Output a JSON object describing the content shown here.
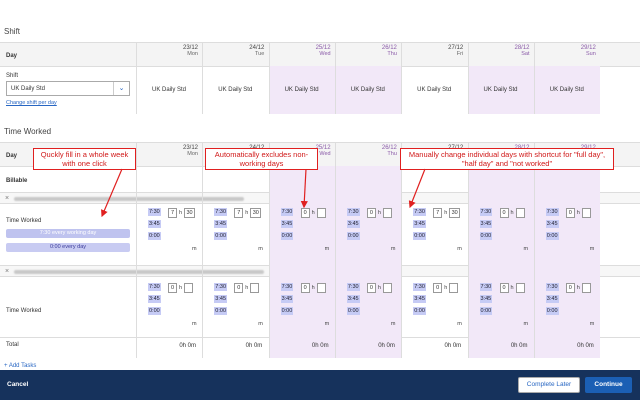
{
  "shift_section": {
    "title": "Shift",
    "day_label": "Day",
    "row_label": "Shift",
    "select_value": "UK Daily Std",
    "change_link": "Change shift per day",
    "cell_value": "UK Daily Std"
  },
  "days": [
    {
      "date": "23/12",
      "name": "Mon",
      "weekend": false
    },
    {
      "date": "24/12",
      "name": "Tue",
      "weekend": false
    },
    {
      "date": "25/12",
      "name": "Wed",
      "weekend": true
    },
    {
      "date": "26/12",
      "name": "Thu",
      "weekend": true
    },
    {
      "date": "27/12",
      "name": "Fri",
      "weekend": false
    },
    {
      "date": "28/12",
      "name": "Sat",
      "weekend": true
    },
    {
      "date": "29/12",
      "name": "Sun",
      "weekend": true
    }
  ],
  "time_worked": {
    "title": "Time Worked",
    "day_label": "Day",
    "billable_label": "Billable",
    "row_label": "Time Worked",
    "fill_every_working_day": "7:30 every working day",
    "fill_every_day": "0:00 every day",
    "total_label": "Total",
    "total_value": "0h 0m",
    "chip_full": "7:30",
    "chip_half": "3:45",
    "chip_zero": "0:00",
    "hours_unit": "h",
    "minutes_unit": "m",
    "edited_hours": "7",
    "edited_minutes": "30",
    "default_hours": "0"
  },
  "callouts": {
    "one_click": "Quckly fill in a whole week with one click",
    "excludes": "Automatically excludes non-working days",
    "manual": "Manually change individual days with shortcut for \"full day\", \"half day\" and \"not worked\""
  },
  "footer": {
    "add_tasks": "+ Add Tasks",
    "cancel": "Cancel",
    "complete_later": "Complete Later",
    "continue": "Continue"
  },
  "colors": {
    "weekend_bg": "#f2e8f8",
    "chip_bg": "#c6cbf5",
    "footer_bg": "#16325c",
    "callout_red": "#e02020",
    "primary_button": "#1b5fb4"
  }
}
